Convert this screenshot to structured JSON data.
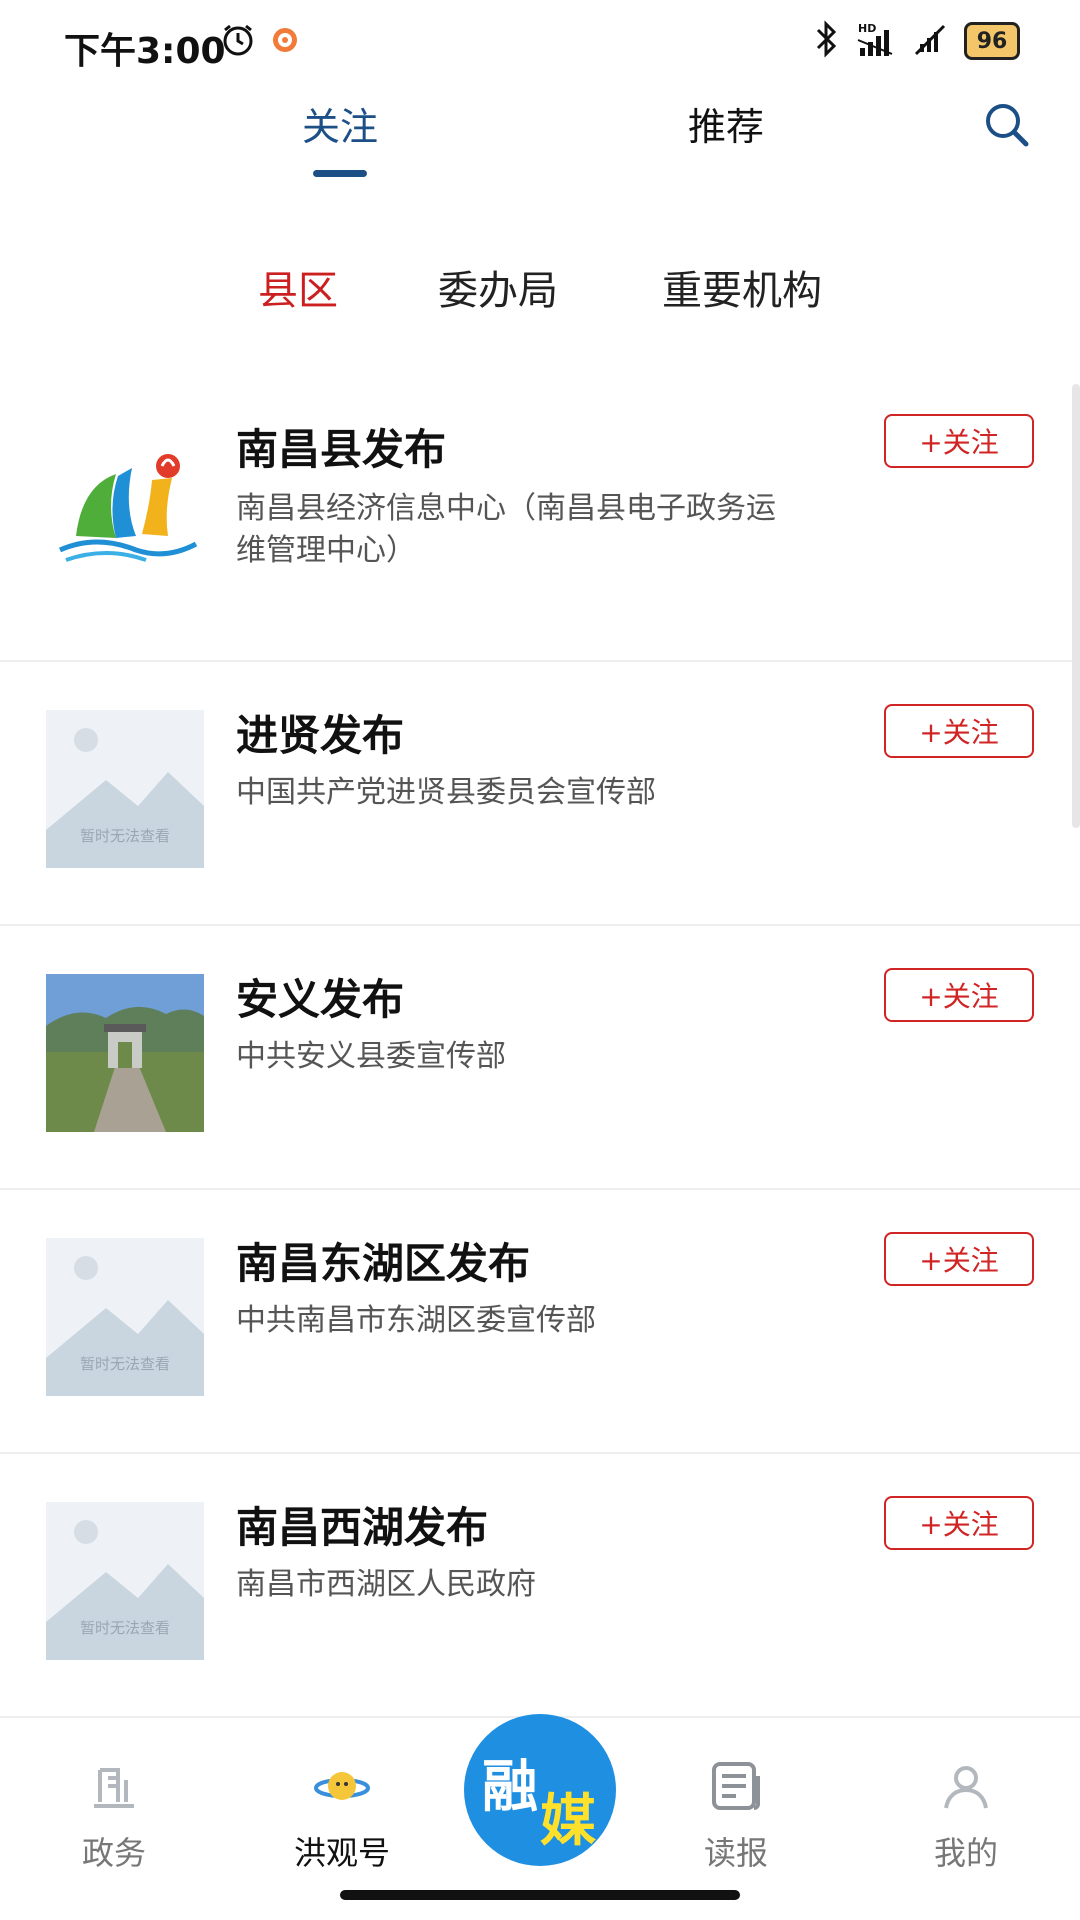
{
  "status_bar": {
    "time": "下午3:00",
    "battery": "96",
    "icons": [
      "alarm-icon",
      "app-notification-icon",
      "bluetooth-icon",
      "hd-signal-icon",
      "signal-icon",
      "battery-icon"
    ]
  },
  "top_tabs": [
    {
      "label": "关注",
      "active": true
    },
    {
      "label": "推荐",
      "active": false
    }
  ],
  "sub_tabs": [
    {
      "label": "县区",
      "active": true
    },
    {
      "label": "委办局",
      "active": false
    },
    {
      "label": "重要机构",
      "active": false
    }
  ],
  "list": [
    {
      "title": "南昌县发布",
      "desc": "南昌县经济信息中心（南昌县电子政务运维管理中心）",
      "follow": "+关注",
      "thumb": "logo"
    },
    {
      "title": "进贤发布",
      "desc": "中国共产党进贤县委员会宣传部",
      "follow": "+关注",
      "thumb": "placeholder",
      "thumb_text": "暂时无法查看"
    },
    {
      "title": "安义发布",
      "desc": "中共安义县委宣传部",
      "follow": "+关注",
      "thumb": "photo"
    },
    {
      "title": "南昌东湖区发布",
      "desc": "中共南昌市东湖区委宣传部",
      "follow": "+关注",
      "thumb": "placeholder",
      "thumb_text": "暂时无法查看"
    },
    {
      "title": "南昌西湖发布",
      "desc": "南昌市西湖区人民政府",
      "follow": "+关注",
      "thumb": "placeholder",
      "thumb_text": "暂时无法查看"
    }
  ],
  "bottom_nav": [
    {
      "label": "政务",
      "icon": "government-icon",
      "active": false
    },
    {
      "label": "洪观号",
      "icon": "planet-icon",
      "active": true
    },
    {
      "label": "融媒",
      "icon": "rongmei-logo",
      "center": true
    },
    {
      "label": "读报",
      "icon": "newspaper-icon",
      "active": false
    },
    {
      "label": "我的",
      "icon": "profile-icon",
      "active": false
    }
  ],
  "colors": {
    "accent_blue": "#1c4f86",
    "accent_red": "#cc1f1f",
    "follow_red": "#d12424"
  }
}
